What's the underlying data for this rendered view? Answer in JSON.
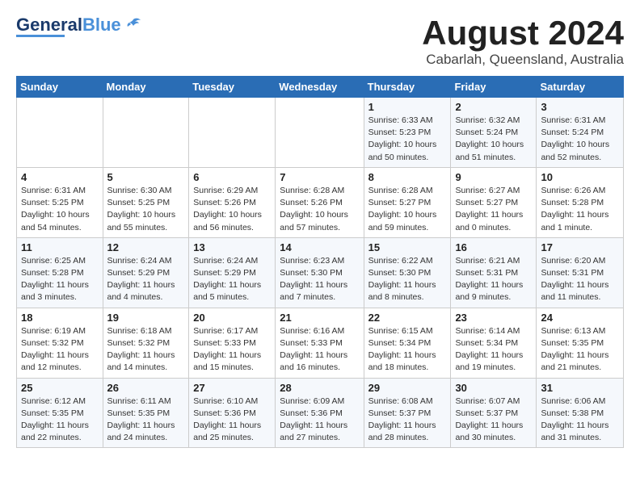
{
  "header": {
    "logo_general": "General",
    "logo_blue": "Blue",
    "month_title": "August 2024",
    "location": "Cabarlah, Queensland, Australia"
  },
  "weekdays": [
    "Sunday",
    "Monday",
    "Tuesday",
    "Wednesday",
    "Thursday",
    "Friday",
    "Saturday"
  ],
  "weeks": [
    [
      {
        "day": "",
        "info": ""
      },
      {
        "day": "",
        "info": ""
      },
      {
        "day": "",
        "info": ""
      },
      {
        "day": "",
        "info": ""
      },
      {
        "day": "1",
        "info": "Sunrise: 6:33 AM\nSunset: 5:23 PM\nDaylight: 10 hours\nand 50 minutes."
      },
      {
        "day": "2",
        "info": "Sunrise: 6:32 AM\nSunset: 5:24 PM\nDaylight: 10 hours\nand 51 minutes."
      },
      {
        "day": "3",
        "info": "Sunrise: 6:31 AM\nSunset: 5:24 PM\nDaylight: 10 hours\nand 52 minutes."
      }
    ],
    [
      {
        "day": "4",
        "info": "Sunrise: 6:31 AM\nSunset: 5:25 PM\nDaylight: 10 hours\nand 54 minutes."
      },
      {
        "day": "5",
        "info": "Sunrise: 6:30 AM\nSunset: 5:25 PM\nDaylight: 10 hours\nand 55 minutes."
      },
      {
        "day": "6",
        "info": "Sunrise: 6:29 AM\nSunset: 5:26 PM\nDaylight: 10 hours\nand 56 minutes."
      },
      {
        "day": "7",
        "info": "Sunrise: 6:28 AM\nSunset: 5:26 PM\nDaylight: 10 hours\nand 57 minutes."
      },
      {
        "day": "8",
        "info": "Sunrise: 6:28 AM\nSunset: 5:27 PM\nDaylight: 10 hours\nand 59 minutes."
      },
      {
        "day": "9",
        "info": "Sunrise: 6:27 AM\nSunset: 5:27 PM\nDaylight: 11 hours\nand 0 minutes."
      },
      {
        "day": "10",
        "info": "Sunrise: 6:26 AM\nSunset: 5:28 PM\nDaylight: 11 hours\nand 1 minute."
      }
    ],
    [
      {
        "day": "11",
        "info": "Sunrise: 6:25 AM\nSunset: 5:28 PM\nDaylight: 11 hours\nand 3 minutes."
      },
      {
        "day": "12",
        "info": "Sunrise: 6:24 AM\nSunset: 5:29 PM\nDaylight: 11 hours\nand 4 minutes."
      },
      {
        "day": "13",
        "info": "Sunrise: 6:24 AM\nSunset: 5:29 PM\nDaylight: 11 hours\nand 5 minutes."
      },
      {
        "day": "14",
        "info": "Sunrise: 6:23 AM\nSunset: 5:30 PM\nDaylight: 11 hours\nand 7 minutes."
      },
      {
        "day": "15",
        "info": "Sunrise: 6:22 AM\nSunset: 5:30 PM\nDaylight: 11 hours\nand 8 minutes."
      },
      {
        "day": "16",
        "info": "Sunrise: 6:21 AM\nSunset: 5:31 PM\nDaylight: 11 hours\nand 9 minutes."
      },
      {
        "day": "17",
        "info": "Sunrise: 6:20 AM\nSunset: 5:31 PM\nDaylight: 11 hours\nand 11 minutes."
      }
    ],
    [
      {
        "day": "18",
        "info": "Sunrise: 6:19 AM\nSunset: 5:32 PM\nDaylight: 11 hours\nand 12 minutes."
      },
      {
        "day": "19",
        "info": "Sunrise: 6:18 AM\nSunset: 5:32 PM\nDaylight: 11 hours\nand 14 minutes."
      },
      {
        "day": "20",
        "info": "Sunrise: 6:17 AM\nSunset: 5:33 PM\nDaylight: 11 hours\nand 15 minutes."
      },
      {
        "day": "21",
        "info": "Sunrise: 6:16 AM\nSunset: 5:33 PM\nDaylight: 11 hours\nand 16 minutes."
      },
      {
        "day": "22",
        "info": "Sunrise: 6:15 AM\nSunset: 5:34 PM\nDaylight: 11 hours\nand 18 minutes."
      },
      {
        "day": "23",
        "info": "Sunrise: 6:14 AM\nSunset: 5:34 PM\nDaylight: 11 hours\nand 19 minutes."
      },
      {
        "day": "24",
        "info": "Sunrise: 6:13 AM\nSunset: 5:35 PM\nDaylight: 11 hours\nand 21 minutes."
      }
    ],
    [
      {
        "day": "25",
        "info": "Sunrise: 6:12 AM\nSunset: 5:35 PM\nDaylight: 11 hours\nand 22 minutes."
      },
      {
        "day": "26",
        "info": "Sunrise: 6:11 AM\nSunset: 5:35 PM\nDaylight: 11 hours\nand 24 minutes."
      },
      {
        "day": "27",
        "info": "Sunrise: 6:10 AM\nSunset: 5:36 PM\nDaylight: 11 hours\nand 25 minutes."
      },
      {
        "day": "28",
        "info": "Sunrise: 6:09 AM\nSunset: 5:36 PM\nDaylight: 11 hours\nand 27 minutes."
      },
      {
        "day": "29",
        "info": "Sunrise: 6:08 AM\nSunset: 5:37 PM\nDaylight: 11 hours\nand 28 minutes."
      },
      {
        "day": "30",
        "info": "Sunrise: 6:07 AM\nSunset: 5:37 PM\nDaylight: 11 hours\nand 30 minutes."
      },
      {
        "day": "31",
        "info": "Sunrise: 6:06 AM\nSunset: 5:38 PM\nDaylight: 11 hours\nand 31 minutes."
      }
    ]
  ]
}
